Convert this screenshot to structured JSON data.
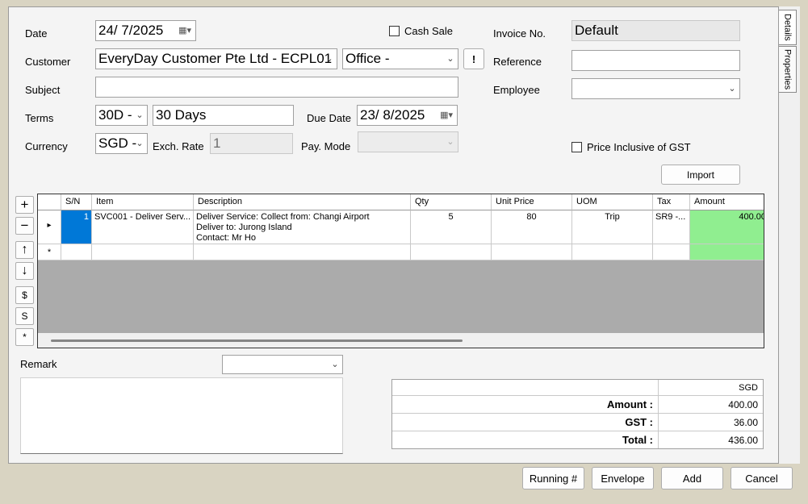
{
  "header": {
    "date_label": "Date",
    "date_value": "24/  7/2025",
    "cash_sale_label": "Cash Sale",
    "invoice_no_label": "Invoice No.",
    "invoice_no_value": "Default",
    "customer_label": "Customer",
    "customer_value": "EveryDay Customer Pte Ltd - ECPL01",
    "branch_value": "Office -",
    "alert_label": "!",
    "reference_label": "Reference",
    "reference_value": "",
    "subject_label": "Subject",
    "subject_value": "",
    "employee_label": "Employee",
    "employee_value": "",
    "terms_label": "Terms",
    "terms_code": "30D -",
    "terms_text": "30 Days",
    "due_date_label": "Due Date",
    "due_date_value": "23/  8/2025",
    "currency_label": "Currency",
    "currency_value": "SGD -",
    "exch_rate_label": "Exch. Rate",
    "exch_rate_value": "1",
    "pay_mode_label": "Pay. Mode",
    "pay_mode_value": "",
    "price_inclusive_label": "Price Inclusive of GST",
    "import_label": "Import"
  },
  "side_tabs": [
    "Details",
    "Properties"
  ],
  "side_buttons": [
    "+",
    "−",
    "↑",
    "↓",
    "$",
    "S",
    "*"
  ],
  "grid": {
    "columns": [
      "S/N",
      "Item",
      "Description",
      "Qty",
      "Unit Price",
      "UOM",
      "Tax",
      "Amount"
    ],
    "rows": [
      {
        "sn": "1",
        "item": "SVC001 - Deliver Serv...",
        "description": [
          "Deliver Service: Collect from: Changi Airport",
          "Deliver to: Jurong Island",
          "Contact: Mr Ho"
        ],
        "qty": "5",
        "unit_price": "80",
        "uom": "Trip",
        "tax": "SR9 -...",
        "amount": "400.00"
      }
    ],
    "new_row_marker": "*",
    "current_row_marker": "▸"
  },
  "remark": {
    "label": "Remark",
    "dropdown_value": "",
    "text": ""
  },
  "totals": {
    "currency": "SGD",
    "amount_label": "Amount :",
    "amount_value": "400.00",
    "gst_label": "GST :",
    "gst_value": "36.00",
    "total_label": "Total :",
    "total_value": "436.00"
  },
  "footer": {
    "running_label": "Running #",
    "envelope_label": "Envelope",
    "add_label": "Add",
    "cancel_label": "Cancel"
  },
  "colors": {
    "selected_cell": "#0078d7",
    "amount_cell": "#90ee90",
    "grid_empty": "#ababab"
  }
}
